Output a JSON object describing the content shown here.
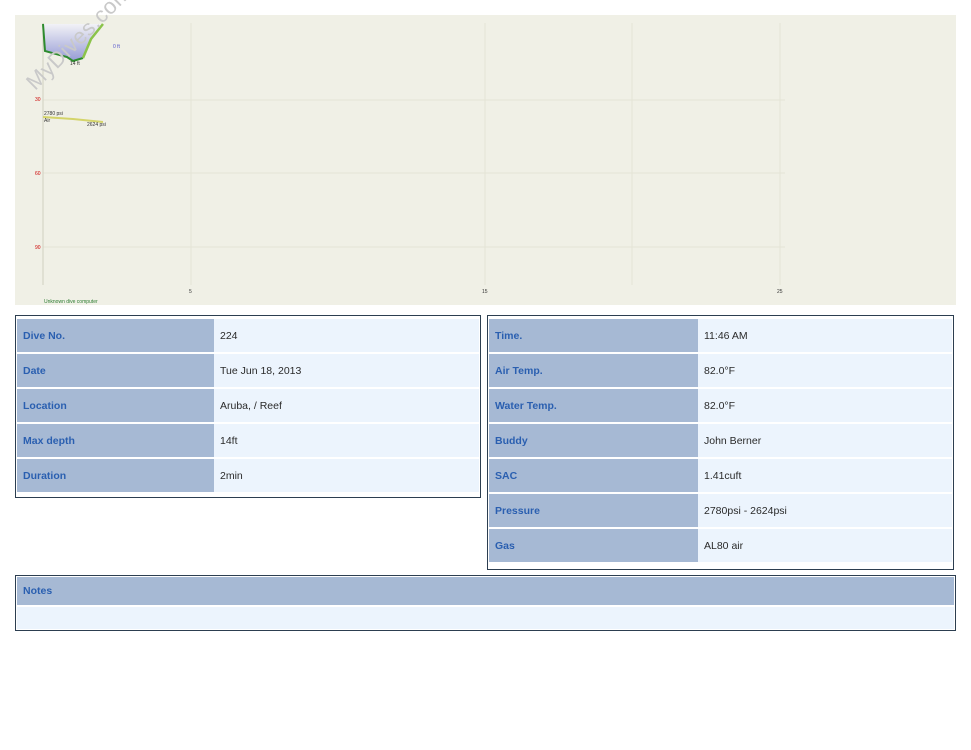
{
  "watermark": "MyDives.com",
  "profile": {
    "depth_labels": [
      "30",
      "60",
      "90"
    ],
    "time_labels": [
      "5",
      "15",
      "25"
    ],
    "max_depth_label": "14 ft",
    "top_right_label": "0 ft",
    "pressure_start": "2780 psi",
    "pressure_end": "2624 psi",
    "gas_label": "Air",
    "computer_label": "Unknown dive computer",
    "colors": {
      "background": "#f0f0e6",
      "profile_line": "#2e8b2e",
      "ascent_line": "#8bc34a",
      "fill": "#9aa0d8",
      "pressure_line": "#d4d46a",
      "depth_tick": "#cc0000"
    }
  },
  "left_table": [
    {
      "key": "Dive No.",
      "value": "224"
    },
    {
      "key": "Date",
      "value": "Tue Jun 18, 2013"
    },
    {
      "key": "Location",
      "value": "Aruba, / Reef"
    },
    {
      "key": "Max depth",
      "value": "14ft"
    },
    {
      "key": "Duration",
      "value": "2min"
    }
  ],
  "right_table": [
    {
      "key": "Time.",
      "value": "11:46 AM"
    },
    {
      "key": "Air Temp.",
      "value": "82.0°F"
    },
    {
      "key": "Water Temp.",
      "value": "82.0°F"
    },
    {
      "key": "Buddy",
      "value": "John Berner"
    },
    {
      "key": "SAC",
      "value": "1.41cuft"
    },
    {
      "key": "Pressure",
      "value": "2780psi - 2624psi"
    },
    {
      "key": "Gas",
      "value": "AL80 air"
    }
  ],
  "notes": {
    "label": "Notes",
    "text": ""
  }
}
